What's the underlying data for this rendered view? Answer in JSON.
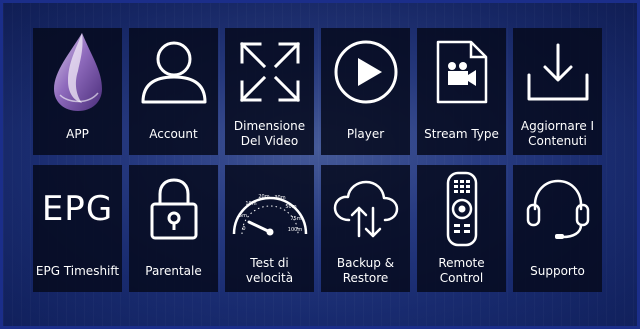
{
  "tiles": [
    {
      "id": "app",
      "label": "APP",
      "icon": "elixir-drop-icon"
    },
    {
      "id": "account",
      "label": "Account",
      "icon": "user-icon"
    },
    {
      "id": "video-size",
      "label": "Dimensione Del Video",
      "icon": "expand-arrows-icon"
    },
    {
      "id": "player",
      "label": "Player",
      "icon": "play-circle-icon"
    },
    {
      "id": "stream-type",
      "label": "Stream Type",
      "icon": "video-file-icon"
    },
    {
      "id": "update",
      "label": "Aggiornare I Contenuti",
      "icon": "download-tray-icon"
    },
    {
      "id": "epg",
      "label": "EPG Timeshift",
      "icon": "epg-text-icon",
      "icon_text": "EPG"
    },
    {
      "id": "parental",
      "label": "Parentale",
      "icon": "padlock-icon"
    },
    {
      "id": "speed-test",
      "label": "Test di velocità",
      "icon": "speedometer-icon"
    },
    {
      "id": "backup",
      "label": "Backup & Restore",
      "icon": "cloud-sync-icon"
    },
    {
      "id": "remote",
      "label": "Remote Control",
      "icon": "remote-control-icon"
    },
    {
      "id": "support",
      "label": "Supporto",
      "icon": "headset-icon"
    }
  ],
  "speedometer_ticks": [
    "0",
    "5m",
    "10m",
    "20m",
    "30m",
    "50m",
    "75m",
    "100m"
  ],
  "colors": {
    "tile_bg": "#060a1e",
    "accent_blue": "#1b2e8a",
    "drop_purple": "#7a5aa8"
  }
}
